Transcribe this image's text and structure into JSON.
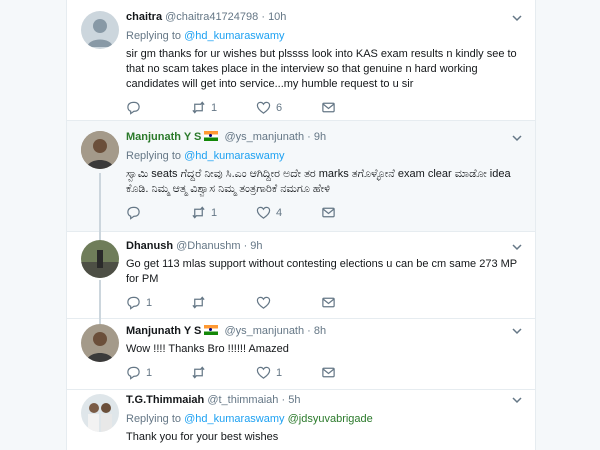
{
  "tweets": [
    {
      "name": "chaitra",
      "handle": "@chaitra41724798",
      "dot": "·",
      "time": "10h",
      "replying_label": "Replying to",
      "replying_to": "@hd_kumaraswamy",
      "text": "sir gm thanks for ur wishes but plssss look into KAS exam results n kindly see to that no scam takes place in the interview so that genuine n hard working candidates will get into service...my humble request to u sir",
      "replies": "",
      "retweets": "1",
      "likes": "6"
    },
    {
      "name": "Manjunath Y S",
      "handle": "@ys_manjunath",
      "dot": "·",
      "time": "9h",
      "replying_label": "Replying to",
      "replying_to": "@hd_kumaraswamy",
      "text": "ಸ್ವಾಮಿ seats ಗೆದ್ದರೆ ನೀವು ಸಿ.ಎಂ ಆಗಿದ್ದೀರ ಅದೇ ತರ marks ತಗೊಳ್ಳೋನೆ exam clear ಮಾಡೋ idea ಕೊಡಿ. ನಿಮ್ಮ ಆತ್ಮ ವಿಶ್ವಾಸ ನಿಮ್ಮ ತಂತ್ರಗಾರಿಕೆ ನಮಗೂ ಹೇಳಿ",
      "replies": "",
      "retweets": "1",
      "likes": "4"
    },
    {
      "name": "Dhanush",
      "handle": "@Dhanushm",
      "dot": "·",
      "time": "9h",
      "text": "Go get 113 mlas support without contesting elections u can be cm same 273 MP for PM",
      "replies": "1",
      "retweets": "",
      "likes": ""
    },
    {
      "name": "Manjunath Y S",
      "handle": "@ys_manjunath",
      "dot": "·",
      "time": "8h",
      "text": "Wow !!!! Thanks Bro !!!!!! Amazed",
      "replies": "1",
      "retweets": "",
      "likes": "1"
    },
    {
      "name": "T.G.Thimmaiah",
      "handle": "@t_thimmaiah",
      "dot": "·",
      "time": "5h",
      "replying_label": "Replying to",
      "replying_to": "@hd_kumaraswamy",
      "replying_to_2": "@jdsyuvabrigade",
      "text": "Thank you for your best wishes"
    }
  ],
  "colors": {
    "link": "#1da1f2",
    "green_name": "#2b7a2b",
    "muted": "#657786",
    "highlight_bg": "#f5f8fa"
  },
  "icons": [
    "reply-icon",
    "retweet-icon",
    "like-icon",
    "message-icon",
    "chevron-down-icon",
    "india-flag-icon"
  ]
}
